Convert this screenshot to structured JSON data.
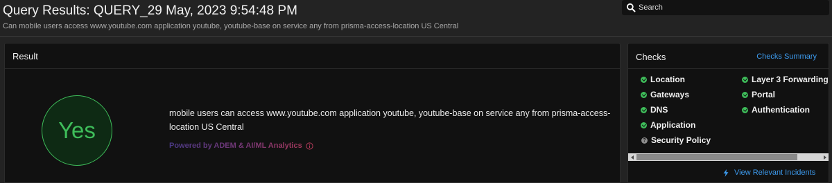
{
  "header": {
    "title": "Query Results: QUERY_29 May, 2023 9:54:48 PM",
    "subtitle": "Can mobile users access www.youtube.com application youtube, youtube-base on service any from prisma-access-location US Central"
  },
  "search": {
    "placeholder": "Search",
    "icon": "search-icon"
  },
  "result": {
    "heading": "Result",
    "verdict": "Yes",
    "answer": "mobile users can access www.youtube.com application youtube, youtube-base on service any from prisma-access-location US Central",
    "powered_by": "Powered by ADEM & AI/ML Analytics",
    "verdict_color": "#3ebd5a"
  },
  "checks": {
    "heading": "Checks",
    "summary_link": "Checks Summary",
    "left": [
      {
        "label": "Location",
        "status": "pass"
      },
      {
        "label": "Gateways",
        "status": "pass"
      },
      {
        "label": "DNS",
        "status": "pass"
      },
      {
        "label": "Application",
        "status": "pass"
      },
      {
        "label": "Security Policy",
        "status": "unknown"
      }
    ],
    "right": [
      {
        "label": "Layer 3 Forwarding",
        "status": "pass"
      },
      {
        "label": "Portal",
        "status": "pass"
      },
      {
        "label": "Authentication",
        "status": "pass"
      }
    ],
    "incidents_link": "View Relevant Incidents",
    "link_color": "#3d9cf0"
  }
}
